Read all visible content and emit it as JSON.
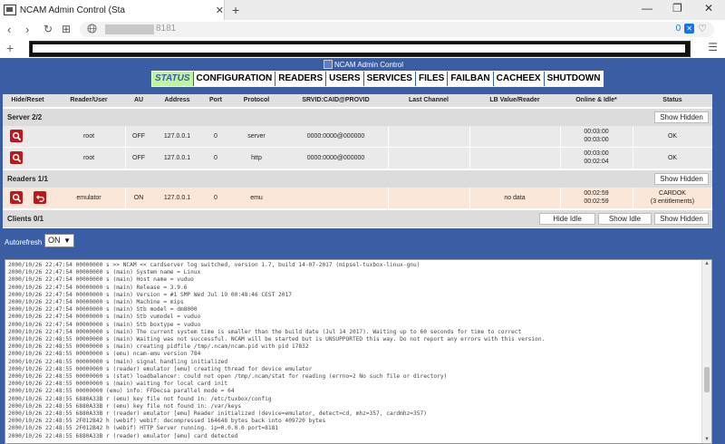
{
  "browser": {
    "tab_title": "NCAM Admin Control (Sta",
    "tab_close": "✕",
    "new_tab": "+",
    "win_min": "—",
    "win_max": "❐",
    "win_close": "✕",
    "nav_back": "‹",
    "nav_forward": "›",
    "nav_reload": "↻",
    "nav_tabs": "⊞",
    "url_port": "8181",
    "url_badge": "0",
    "url_shield": "✕",
    "url_heart": "♡",
    "bookmark_plus": "+",
    "bookmark_menu": "☰"
  },
  "page": {
    "logo_alt": "NCAM Admin Control",
    "menu": [
      "STATUS",
      "CONFIGURATION",
      "READERS",
      "USERS",
      "SERVICES",
      "FILES",
      "FAILBAN",
      "CACHEEX",
      "SHUTDOWN"
    ],
    "headers": [
      "Hide/Reset",
      "Reader/User",
      "AU",
      "Address",
      "Port",
      "Protocol",
      "SRVID:CAID@PROVID",
      "Last Channel",
      "LB Value/Reader",
      "Online & Idle*",
      "Status"
    ],
    "server_section": {
      "label": "Server 2/2",
      "button": "Show Hidden"
    },
    "server_rows": [
      {
        "user": "root",
        "au": "OFF",
        "address": "127.0.0.1",
        "port": "0",
        "protocol": "server",
        "srvid": "0000:0000@000000",
        "online": "00:03:00",
        "idle": "00:03:00",
        "status": "OK"
      },
      {
        "user": "root",
        "au": "OFF",
        "address": "127.0.0.1",
        "port": "0",
        "protocol": "http",
        "srvid": "0000:0000@000000",
        "online": "00:03:00",
        "idle": "00:02:04",
        "status": "OK"
      }
    ],
    "readers_section": {
      "label": "Readers 1/1",
      "button": "Show Hidden"
    },
    "reader_rows": [
      {
        "user": "emulator",
        "au": "ON",
        "address": "127.0.0.1",
        "port": "0",
        "protocol": "emu",
        "lb": "no data",
        "online": "00:02:59",
        "idle": "00:02:59",
        "status1": "CARDOK",
        "status2": "(3 entitlements)"
      }
    ],
    "clients_section": {
      "label": "Clients 0/1",
      "btn_hide_idle": "Hide Idle",
      "btn_show_idle": "Show Idle",
      "btn_show_hidden": "Show Hidden"
    },
    "autorefresh_label": "Autorefresh",
    "autorefresh_value": "ON",
    "log_lines": [
      "2000/10/26 22:47:54 00000000 s >> NCAM << cardserver log switched, version 1.7, build 14-07-2017 (mipsel-tuxbox-linux-gnu)",
      "2000/10/26 22:47:54 00000000 s (main) System name = Linux",
      "2000/10/26 22:47:54 00000000 s (main) Host name = vuduo",
      "2000/10/26 22:47:54 00000000 s (main) Release = 3.9.6",
      "2000/10/26 22:47:54 00000000 s (main) Version = #1 SMP Wed Jul 19 00:48:46 CEST 2017",
      "2000/10/26 22:47:54 00000000 s (main) Machine = mips",
      "2000/10/26 22:47:54 00000000 s (main) Stb model = dm8000",
      "2000/10/26 22:47:54 00000000 s (main) Stb vumodel = vuduo",
      "2000/10/26 22:47:54 00000000 s (main) Stb boxtype = vuduo",
      "2000/10/26 22:47:54 00000000 s (main) The current system time is smaller than the build date (Jul 14 2017). Waiting up to 60 seconds for time to correct",
      "2000/10/26 22:48:55 00000000 s (main) Waiting was not successful. NCAM will be started but is UNSUPPORTED this way. Do not report any errors with this version.",
      "2000/10/26 22:48:55 00000000 s (main) creating pidfile /tmp/.ncam/ncam.pid with pid 17832",
      "2000/10/26 22:48:55 00000000 s (emu) ncam-emu version 784",
      "2000/10/26 22:48:55 00000000 s (main) signal handling initialized",
      "2000/10/26 22:48:55 00000000 s (reader) emulator [emu] creating thread for device emulator",
      "2000/10/26 22:48:55 00000000 s (stat) loadbalancer: could not open /tmp/.ncam/stat for reading (errno=2 No such file or directory)",
      "2000/10/26 22:48:55 00000000 s (main) waiting for local card init",
      "2000/10/26 22:48:55 00000000 (emu) info: FFDecsa parallel mode = 64",
      "2000/10/26 22:48:55 6880A33B r (emu) key file not found in: /etc/tuxbox/config",
      "2000/10/26 22:48:55 6880A33B r (emu) key file not found in: /var/keys",
      "2000/10/26 22:48:55 6880A33B r (reader) emulator [emu] Reader initialized (device=emulator, detect=cd, mhz=357, cardmhz=357)",
      "2000/10/26 22:48:55 2F012B42 h (webif) webif: decompressed 164648 bytes back into 409720 bytes",
      "2000/10/26 22:48:55 2F012B42 h (webif) HTTP Server running. ip=0.0.0.0 port=8181",
      "2000/10/26 22:48:55 6880A33B r (reader) emulator [emu] card detected"
    ],
    "scroll_up": "▲",
    "scroll_down": "▼"
  }
}
